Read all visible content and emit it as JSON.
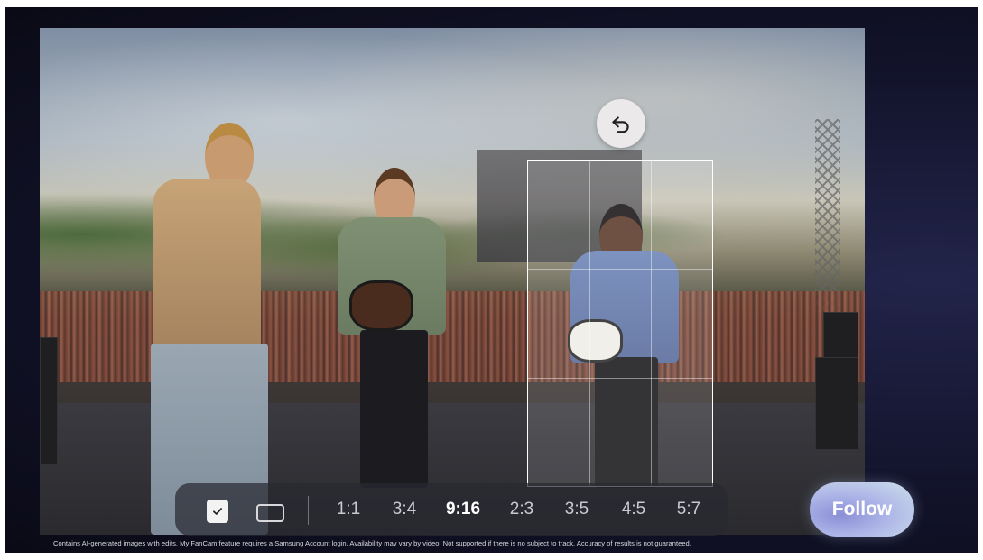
{
  "screen": {
    "undo_icon": "undo-icon",
    "check_icon": "check-icon",
    "full_frame_icon": "rectangle-icon"
  },
  "ratio_bar": {
    "ratios": [
      "1:1",
      "3:4",
      "9:16",
      "2:3",
      "3:5",
      "4:5",
      "5:7"
    ],
    "selected": "9:16"
  },
  "follow_button": {
    "label": "Follow"
  },
  "disclaimer": "Contains AI-generated images with edits. My FanCam feature requires a Samsung Account login. Availability may vary by video. Not supported if there is no subject to track. Accuracy of results is not guaranteed.",
  "colors": {
    "background": "#12132a",
    "follow_gradient_start": "#8a8fd6",
    "follow_gradient_end": "#cfe0ea",
    "bar_background": "#28283080"
  }
}
